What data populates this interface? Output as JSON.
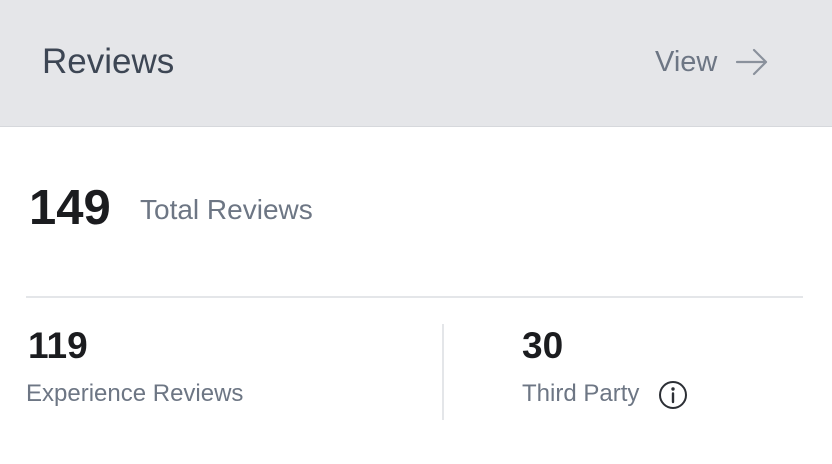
{
  "header": {
    "title": "Reviews",
    "view_label": "View",
    "view_icon": "arrow-right-icon",
    "background": "#e5e6e9"
  },
  "total": {
    "count": "149",
    "label": "Total Reviews"
  },
  "breakdown": [
    {
      "count": "119",
      "label": "Experience Reviews"
    },
    {
      "count": "30",
      "label": "Third Party",
      "icon": "info-icon"
    }
  ],
  "colors": {
    "heading_text": "#3d4654",
    "muted_text": "#6d7684",
    "number_text": "#1b1c1f",
    "divider": "#e4e6e9"
  }
}
